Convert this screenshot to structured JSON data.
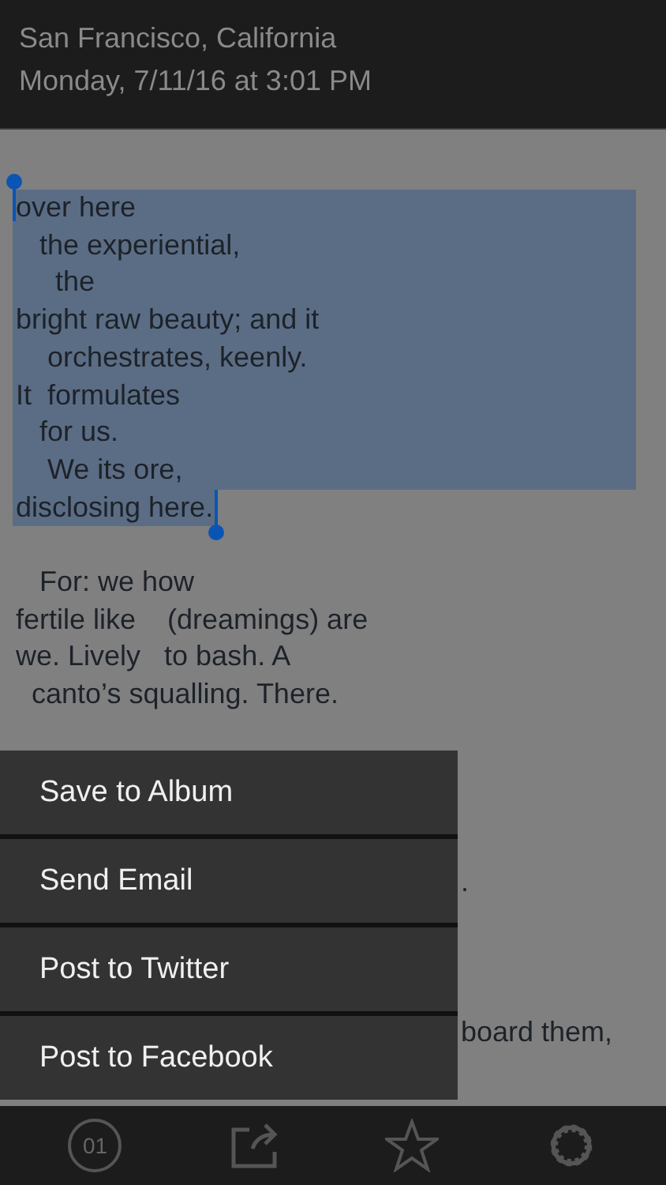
{
  "header": {
    "location": "San Francisco, California",
    "datetime": "Monday, 7/11/16 at 3:01 PM"
  },
  "poem": [
    {
      "text": "over here",
      "selected": true
    },
    {
      "text": "   the experiential,",
      "selected": true
    },
    {
      "text": "     the",
      "selected": true
    },
    {
      "text": "bright raw beauty; and it",
      "selected": true
    },
    {
      "text": "    orchestrates, keenly.",
      "selected": true
    },
    {
      "text": "It  formulates",
      "selected": true
    },
    {
      "text": "   for us.",
      "selected": true
    },
    {
      "text": "    We its ore,",
      "selected": true
    },
    {
      "text": "disclosing here.",
      "selected": true
    },
    {
      "text": "   For: we how",
      "selected": false
    },
    {
      "text": "fertile like    (dreamings) are",
      "selected": false
    },
    {
      "text": "we. Lively   to bash. A",
      "selected": false
    },
    {
      "text": "  canto’s squalling. There.",
      "selected": false
    }
  ],
  "covered_fragments": [
    ".",
    "board them,"
  ],
  "menu": [
    "Save to Album",
    "Send Email",
    "Post to Twitter",
    "Post to Facebook"
  ],
  "tabbar": {
    "counter": "01"
  }
}
